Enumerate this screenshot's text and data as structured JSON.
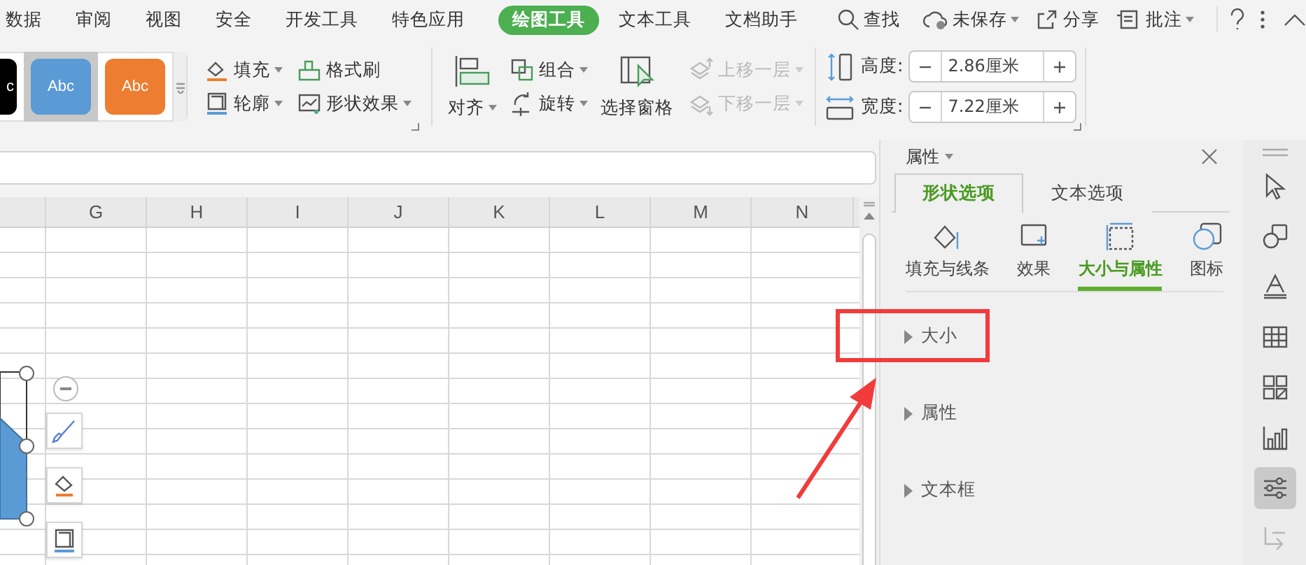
{
  "menu_tabs": [
    {
      "label": "数据",
      "selected": false
    },
    {
      "label": "审阅",
      "selected": false
    },
    {
      "label": "视图",
      "selected": false
    },
    {
      "label": "安全",
      "selected": false
    },
    {
      "label": "开发工具",
      "selected": false
    },
    {
      "label": "特色应用",
      "selected": false
    },
    {
      "label": "绘图工具",
      "selected": true
    },
    {
      "label": "文本工具",
      "selected": false
    },
    {
      "label": "文档助手",
      "selected": false
    }
  ],
  "search": {
    "label": "查找"
  },
  "quick_actions": [
    {
      "label": "未保存",
      "dropdown": true
    },
    {
      "label": "分享",
      "dropdown": false
    },
    {
      "label": "批注",
      "dropdown": true
    }
  ],
  "ribbon": {
    "style_gallery": [
      {
        "label": "c",
        "color": "#000000",
        "selected": false
      },
      {
        "label": "Abc",
        "color": "#5b9bd5",
        "selected": true
      },
      {
        "label": "Abc",
        "color": "#ed7d31",
        "selected": false
      }
    ],
    "format_buttons": [
      {
        "label": "填充",
        "dropdown": true
      },
      {
        "label": "格式刷",
        "dropdown": false
      },
      {
        "label": "轮廓",
        "dropdown": true
      },
      {
        "label": "形状效果",
        "dropdown": true
      }
    ],
    "align": {
      "label": "对齐",
      "dropdown": true
    },
    "group_buttons": [
      {
        "label": "组合",
        "dropdown": true
      },
      {
        "label": "旋转",
        "dropdown": true
      }
    ],
    "selection_pane": {
      "label": "选择窗格"
    },
    "layer_buttons": [
      {
        "label": "上移一层",
        "disabled": true
      },
      {
        "label": "下移一层",
        "disabled": true
      }
    ],
    "size_fields": [
      {
        "label": "高度:",
        "value": "2.86厘米"
      },
      {
        "label": "宽度:",
        "value": "7.22厘米"
      }
    ]
  },
  "sheet": {
    "columns": [
      "G",
      "H",
      "I",
      "J",
      "K",
      "L",
      "M",
      "N"
    ]
  },
  "panel": {
    "title": "属性",
    "tabs": [
      {
        "label": "形状选项",
        "selected": true
      },
      {
        "label": "文本选项",
        "selected": false
      }
    ],
    "subtabs": [
      {
        "label": "填充与线条",
        "selected": false
      },
      {
        "label": "效果",
        "selected": false
      },
      {
        "label": "大小与属性",
        "selected": true
      },
      {
        "label": "图标",
        "selected": false
      }
    ],
    "sections": [
      {
        "label": "大小",
        "expanded": false,
        "highlighted": true
      },
      {
        "label": "属性",
        "expanded": false,
        "highlighted": false
      },
      {
        "label": "文本框",
        "expanded": false,
        "highlighted": false
      }
    ]
  },
  "sidebar_tools": [
    {
      "selected": false,
      "disabled": false
    },
    {
      "selected": false,
      "disabled": false
    },
    {
      "selected": false,
      "disabled": false
    },
    {
      "selected": false,
      "disabled": false
    },
    {
      "selected": false,
      "disabled": false
    },
    {
      "selected": false,
      "disabled": false
    },
    {
      "selected": true,
      "disabled": false
    },
    {
      "selected": false,
      "disabled": true
    }
  ]
}
